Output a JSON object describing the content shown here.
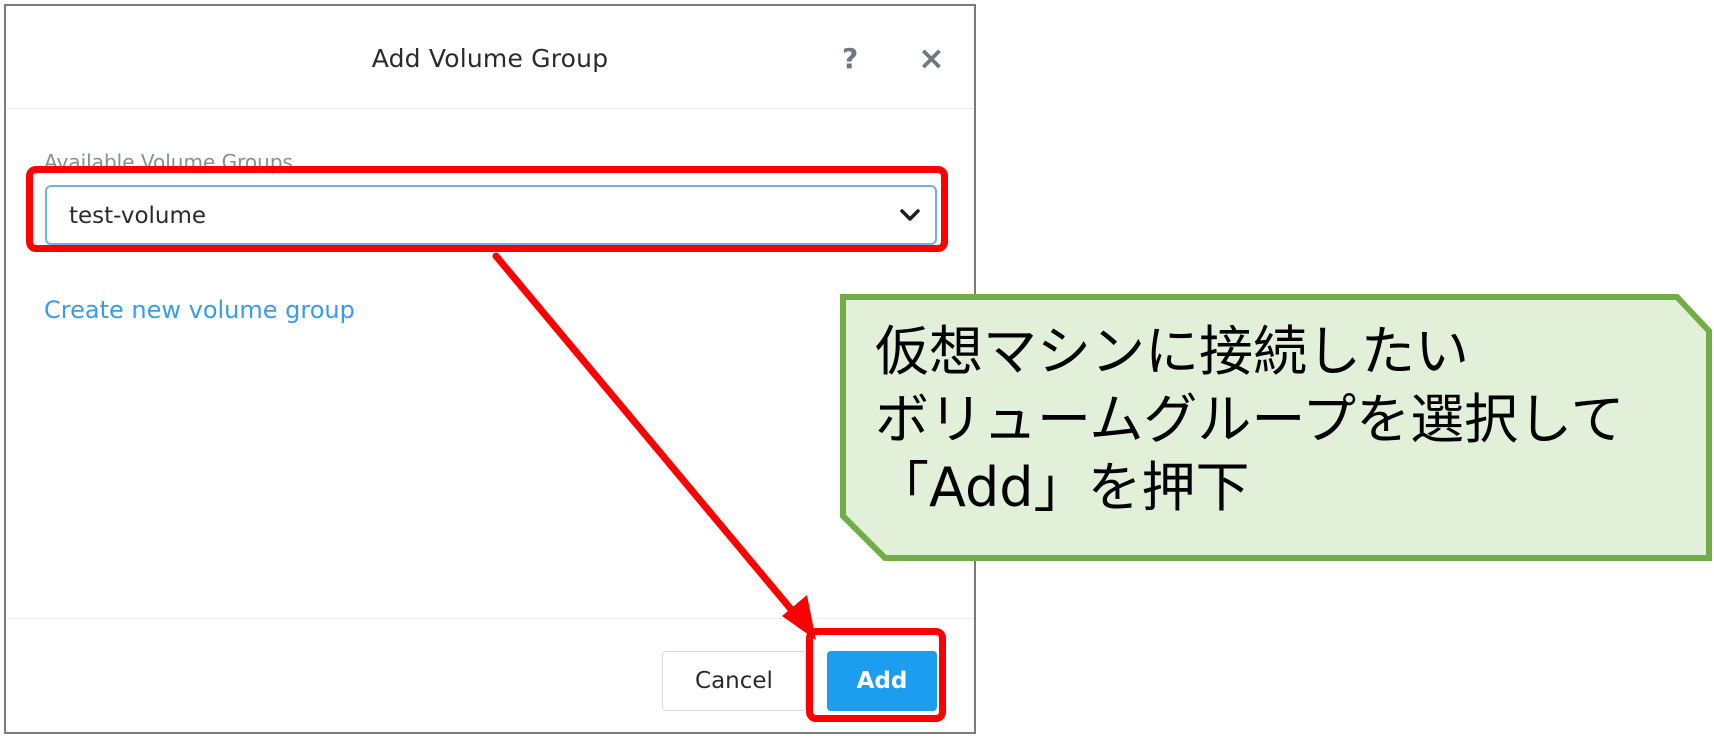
{
  "dialog": {
    "title": "Add Volume Group",
    "help_symbol": "?",
    "close_symbol": "×",
    "field_label": "Available Volume Groups",
    "select": {
      "value": "test-volume",
      "icon": "chevron-down-icon"
    },
    "create_link": "Create new volume group",
    "cancel_label": "Cancel",
    "add_label": "Add"
  },
  "annotation": {
    "lines": [
      "仮想マシンに接続したい",
      "ボリュームグループを選択して",
      "「Add」を押下"
    ],
    "callout_fill": "#e2efd9",
    "callout_border": "#70ad47",
    "highlight_color": "#ff0000"
  },
  "colors": {
    "primary_button": "#1b9ef0",
    "link": "#3a9ce8",
    "select_border": "#6fb0e8"
  }
}
